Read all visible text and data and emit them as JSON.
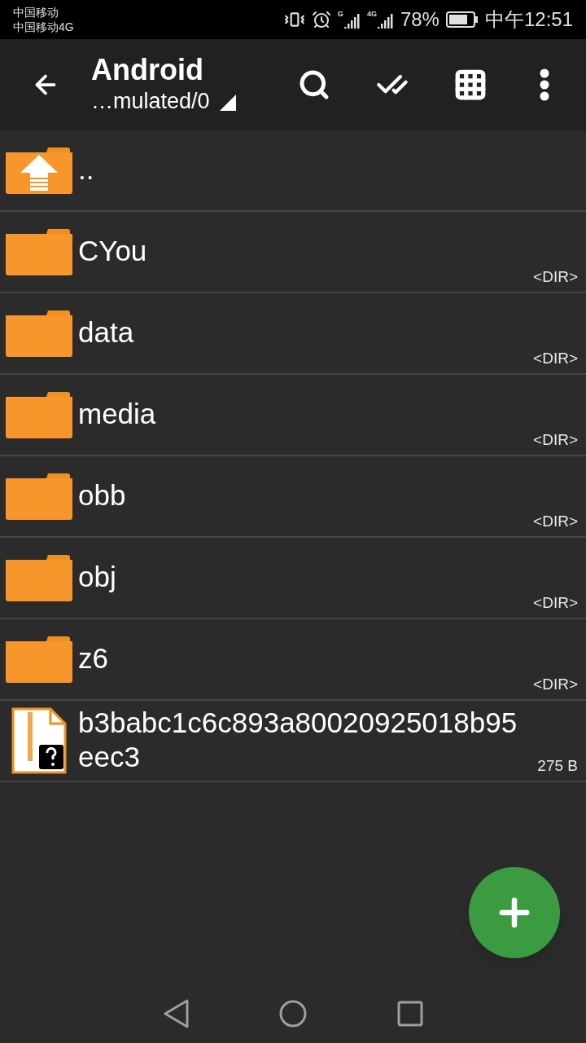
{
  "status_bar": {
    "carrier_1": "中国移动",
    "carrier_2": "中国移动4G",
    "signal_1_label": "G",
    "signal_2_label": "4G",
    "battery": "78%",
    "time": "中午12:51"
  },
  "toolbar": {
    "title": "Android",
    "path": "…mulated/0"
  },
  "files": [
    {
      "kind": "parent",
      "name": ".."
    },
    {
      "kind": "folder",
      "name": "CYou",
      "info": "<DIR>"
    },
    {
      "kind": "folder",
      "name": "data",
      "info": "<DIR>"
    },
    {
      "kind": "folder",
      "name": "media",
      "info": "<DIR>"
    },
    {
      "kind": "folder",
      "name": "obb",
      "info": "<DIR>"
    },
    {
      "kind": "folder",
      "name": "obj",
      "info": "<DIR>"
    },
    {
      "kind": "folder",
      "name": "z6",
      "info": "<DIR>"
    },
    {
      "kind": "file",
      "name": "b3babc1c6c893a80020925018b95eec3",
      "info": "275 B"
    }
  ]
}
